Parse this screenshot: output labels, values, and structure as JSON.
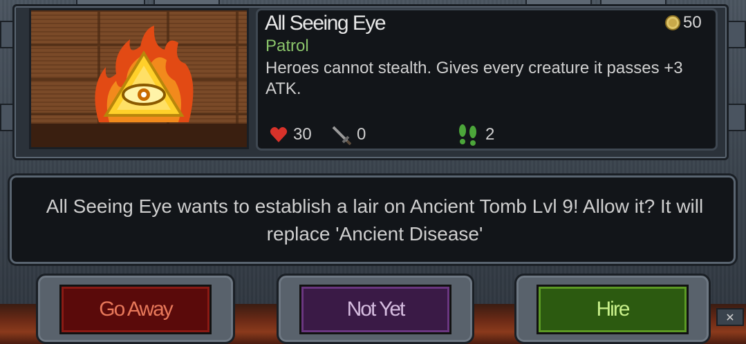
{
  "card": {
    "name": "All Seeing Eye",
    "type": "Patrol",
    "description": "Heroes cannot stealth. Gives every creature it passes +3 ATK.",
    "cost": "50",
    "cost_icon": "gold-coin-icon",
    "stats": {
      "health": "30",
      "health_icon": "heart-icon",
      "attack": "0",
      "attack_icon": "sword-icon",
      "speed": "2",
      "speed_icon": "footprints-icon"
    }
  },
  "message": "All Seeing Eye wants to establish a lair on Ancient Tomb Lvl 9! Allow it? It will replace 'Ancient Disease'",
  "buttons": {
    "go_away": "Go Away",
    "not_yet": "Not Yet",
    "hire": "Hire"
  },
  "colors": {
    "go_away": "#5a0a0a",
    "not_yet": "#3a1a46",
    "hire": "#2c5a10",
    "type_text": "#8ac46a"
  }
}
